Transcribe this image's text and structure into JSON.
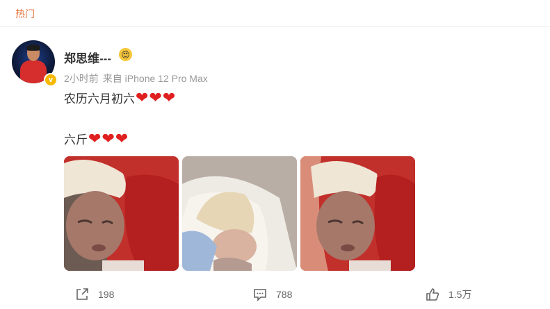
{
  "header": {
    "hot_label": "热门"
  },
  "post": {
    "username": "郑思维---",
    "user_badge_emoji": "😍",
    "time": "2小时前",
    "source": "来自 iPhone 12 Pro Max",
    "line1_text": "农历六月初六",
    "line2_text": "六斤",
    "heart_glyph": "❤",
    "heart_color": "#e02020",
    "verified_mark": "v"
  },
  "actions": {
    "share_count": "198",
    "comment_count": "788",
    "like_count": "1.5万"
  },
  "colors": {
    "hot_label": "#e8743b",
    "verified_badge": "#f6b900",
    "meta_text": "#999999"
  }
}
